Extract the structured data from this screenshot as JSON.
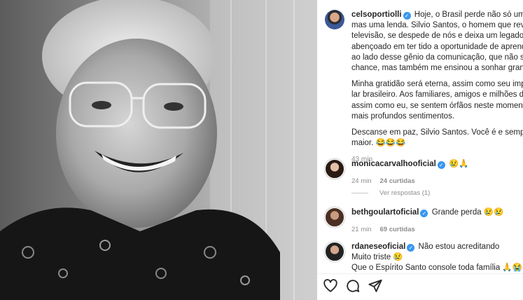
{
  "post": {
    "username": "celsoportiolli",
    "verified": true,
    "paragraphs": [
      [
        "Hoje, o Brasil perde não só um comunicador,",
        "mas uma lenda. Silvio Santos, o homem que revolucionou a",
        "televisão, se despede de nós e deixa um legado eterno. Sou",
        "abençoado em ter tido a oportunidade de aprender e crescer",
        "ao lado desse gênio da comunicação, que não só me deu a",
        "chance, mas também me ensinou a sonhar grande."
      ],
      [
        "Minha gratidão será eterna, assim como seu impacto em cada",
        "lar brasileiro. Aos familiares, amigos e milhões de fãs que,",
        "assim como eu, se sentem órfãos neste momento, deixo meus",
        "mais profundos sentimentos."
      ],
      [
        "Descanse em paz, Silvio Santos. Você é e sempre será",
        "maior. 😂😂😂"
      ]
    ],
    "time": "43 min"
  },
  "comments": [
    {
      "username": "monicacarvalhooficial",
      "text": "😢🙏",
      "time": "24 min",
      "likes": "24 curtidas"
    },
    {
      "username": "bethgoulartoficial",
      "text": "Grande perda 😢😢",
      "time": "21 min",
      "likes": "69 curtidas"
    },
    {
      "username": "rdaneseoficial",
      "text": "Não estou acreditando",
      "lines": [
        "Muito triste 😢",
        "Que o Espírito Santo console toda família 🙏😭"
      ]
    }
  ],
  "replies_label": "Ver respostas (1)",
  "icons": {
    "like": "heart-icon",
    "comment": "comment-icon",
    "share": "share-icon"
  }
}
